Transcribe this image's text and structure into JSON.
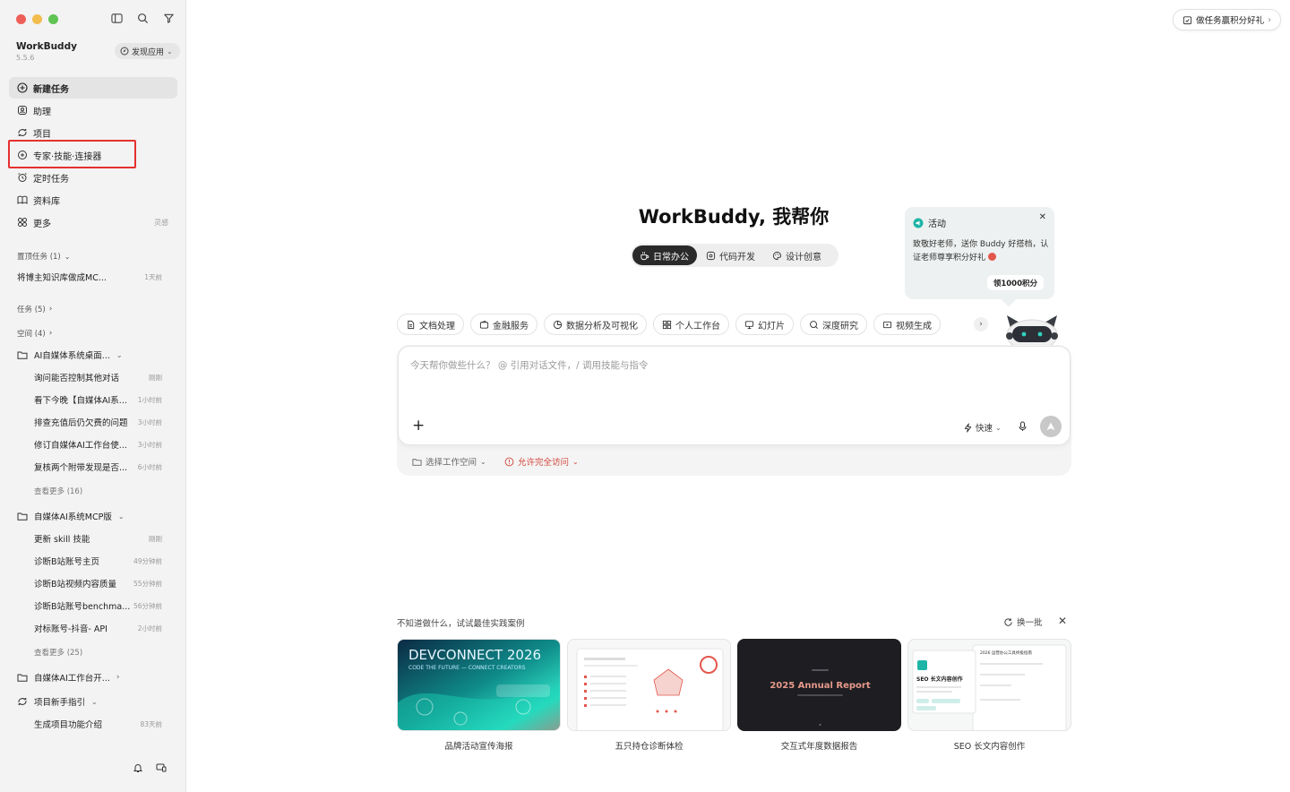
{
  "sidebar": {
    "app_name": "WorkBuddy",
    "version": "5.5.6",
    "discover_label": "发现应用",
    "nav": [
      {
        "label": "新建任务"
      },
      {
        "label": "助理"
      },
      {
        "label": "项目"
      },
      {
        "label": "专家·技能·连接器"
      },
      {
        "label": "定时任务"
      },
      {
        "label": "资料库"
      },
      {
        "label": "更多",
        "aside": "灵感"
      }
    ],
    "pinned": {
      "label": "置顶任务 (1)",
      "items": [
        {
          "title": "将博主知识库做成MC...",
          "time": "1天前"
        }
      ]
    },
    "tasks_label": "任务 (5)",
    "spaces_label": "空间 (4)",
    "space1": {
      "name": "AI自媒体系统桌面...",
      "items": [
        {
          "title": "询问能否控制其他对话",
          "time": "刚刚"
        },
        {
          "title": "看下今晚【自媒体AI系...",
          "time": "1小时前"
        },
        {
          "title": "排查充值后仍欠费的问题",
          "time": "3小时前"
        },
        {
          "title": "修订自媒体AI工作台使...",
          "time": "3小时前"
        },
        {
          "title": "复核两个附带发现是否...",
          "time": "6小时前"
        }
      ],
      "more": "查看更多 (16)"
    },
    "space2": {
      "name": "自媒体AI系统MCP版",
      "items": [
        {
          "title": "更新 skill 技能",
          "time": "刚刚"
        },
        {
          "title": "诊断B站账号主页",
          "time": "49分钟前"
        },
        {
          "title": "诊断B站视频内容质量",
          "time": "55分钟前"
        },
        {
          "title": "诊断B站账号benchma...",
          "time": "56分钟前"
        },
        {
          "title": "对标账号-抖音- API",
          "time": "2小时前"
        }
      ],
      "more": "查看更多 (25)"
    },
    "space3": {
      "name": "自媒体AI工作台开..."
    },
    "space4": {
      "name": "项目新手指引",
      "items": [
        {
          "title": "生成项目功能介绍",
          "time": "83天前"
        }
      ]
    }
  },
  "main": {
    "promo_label": "做任务赢积分好礼",
    "hero_title": "WorkBuddy, 我帮你",
    "modes": [
      "日常办公",
      "代码开发",
      "设计创意"
    ],
    "activity": {
      "title": "活动",
      "body": "致敬好老师，送你 Buddy 好搭档，认证老师尊享积分好礼",
      "button": "领1000积分"
    },
    "chips": [
      "文档处理",
      "金融服务",
      "数据分析及可视化",
      "个人工作台",
      "幻灯片",
      "深度研究",
      "视频生成"
    ],
    "composer": {
      "placeholder": "今天帮你做些什么？ @ 引用对话文件，/ 调用技能与指令",
      "speed_label": "快速",
      "workspace_label": "选择工作空间",
      "permission_label": "允许完全访问"
    },
    "cases": {
      "title": "不知道做什么，试试最佳实践案例",
      "refresh_label": "换一批",
      "items": [
        {
          "caption": "品牌活动宣传海报",
          "thumb_title": "DEVCONNECT 2026",
          "thumb_sub": "CODE THE FUTURE — CONNECT CREATORS"
        },
        {
          "caption": "五只持仓诊断体检"
        },
        {
          "caption": "交互式年度数据报告",
          "thumb_title": "2025 Annual Report"
        },
        {
          "caption": "SEO 长文内容创作",
          "thumb_title": "SEO 长文内容创作",
          "thumb_side": "2026 运营办公工具终极指南"
        }
      ]
    }
  },
  "colors": {
    "accent_red": "#e5312f",
    "dark": "#2a2a2a",
    "teal": "#1fb5a6"
  }
}
